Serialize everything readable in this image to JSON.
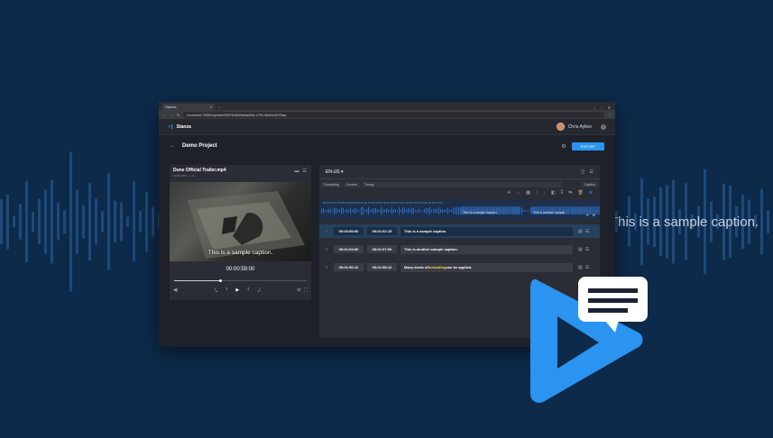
{
  "overlay_caption": "This is a sample caption.",
  "browser": {
    "tab_title": "Stanza",
    "new_tab": "+",
    "address": "localhost:7800/caption/38576d849a8a4f3e-c7f9-4b60c3475aa",
    "win_min": "–",
    "win_max": "▫",
    "win_close": "✕",
    "nav_back": "←",
    "nav_forward": "→",
    "nav_reload": "↻"
  },
  "app": {
    "logo_glyph": "◖)",
    "name": "Stanza",
    "user_name": "Chris Aylion",
    "help_glyph": "?"
  },
  "project": {
    "back_glyph": "←",
    "title": "Demo Project",
    "settings_glyph": "⚙",
    "export_label": "EXPORT"
  },
  "video": {
    "title": "Dune Official Trailer.mp4",
    "subtitle": "1920x1080 · 2 of 1",
    "overlay_caption": "This is a sample caption.",
    "timecode": "00:00:59:00",
    "progress": 0.35,
    "folder_icon": "folder-icon",
    "menu_icon": "menu-icon"
  },
  "editor": {
    "language": "EN-US",
    "language_chevron": "▾",
    "tabs": [
      "Formatting",
      "Content",
      "Timing"
    ],
    "caption_tab": "Caption",
    "ruler": "00:00:20:00   00:00:30:00   00:00:40:00   00:00:50:00   00:01:00:00   00:01:10:00   00:01:20:00   00:01:30:00",
    "wave_labels": [
      "This is a sample caption.",
      "This is another sample..."
    ],
    "rows": [
      {
        "num": "1",
        "start": "00:00:59:00",
        "end": "00:01:02:15",
        "text": "This is a sample caption.",
        "active": true
      },
      {
        "num": "2",
        "start": "00:01:04:00",
        "end": "00:01:07:00",
        "text": "This is another sample caption.",
        "active": false
      },
      {
        "num": "3",
        "start": "00:01:56:12",
        "end": "00:01:58:12",
        "text_before": "Many kinds of ",
        "text_hl": "formatting",
        "text_after": " can be applied.",
        "active": false
      }
    ]
  },
  "colors": {
    "background": "#0d2a4a",
    "accent": "#2b94f0",
    "highlight": "#f5d547"
  }
}
